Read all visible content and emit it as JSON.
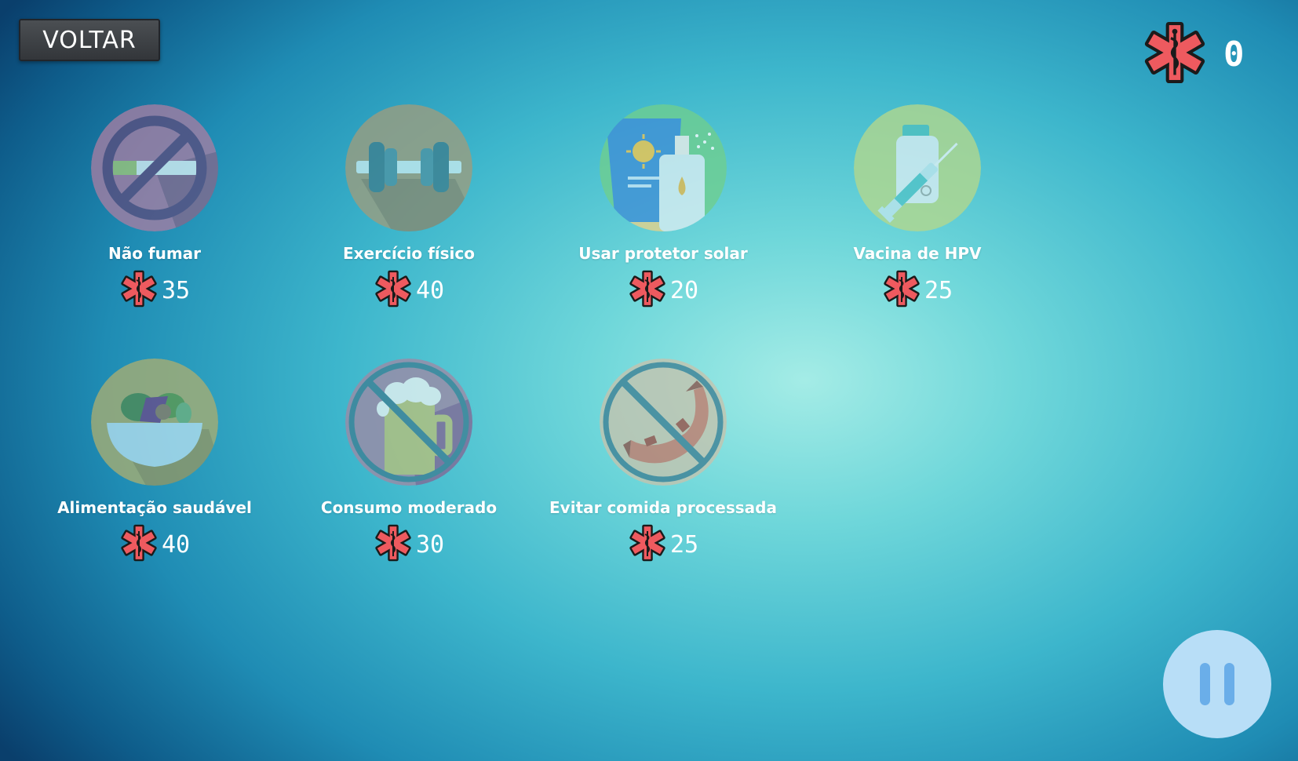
{
  "back_button": {
    "label": "VOLTAR"
  },
  "score": {
    "value": "0",
    "icon": "star-of-life-icon"
  },
  "currency_icon": "star-of-life-icon",
  "items": [
    {
      "name": "Não fumar",
      "cost": "35",
      "icon": "no-smoking-icon"
    },
    {
      "name": "Exercício físico",
      "cost": "40",
      "icon": "dumbbell-icon"
    },
    {
      "name": "Usar protetor solar",
      "cost": "20",
      "icon": "sunscreen-icon"
    },
    {
      "name": "Vacina de HPV",
      "cost": "25",
      "icon": "vaccine-icon"
    },
    {
      "name": "Alimentação saudável",
      "cost": "40",
      "icon": "salad-bowl-icon"
    },
    {
      "name": "Consumo moderado",
      "cost": "30",
      "icon": "no-beer-icon"
    },
    {
      "name": "Evitar comida processada",
      "cost": "25",
      "icon": "no-sausage-icon"
    }
  ],
  "pause_button": {
    "icon": "pause-icon"
  },
  "colors": {
    "currency": "#ee5a5f",
    "pause_bg": "#b8def7",
    "button_bg": "#3d4045"
  }
}
